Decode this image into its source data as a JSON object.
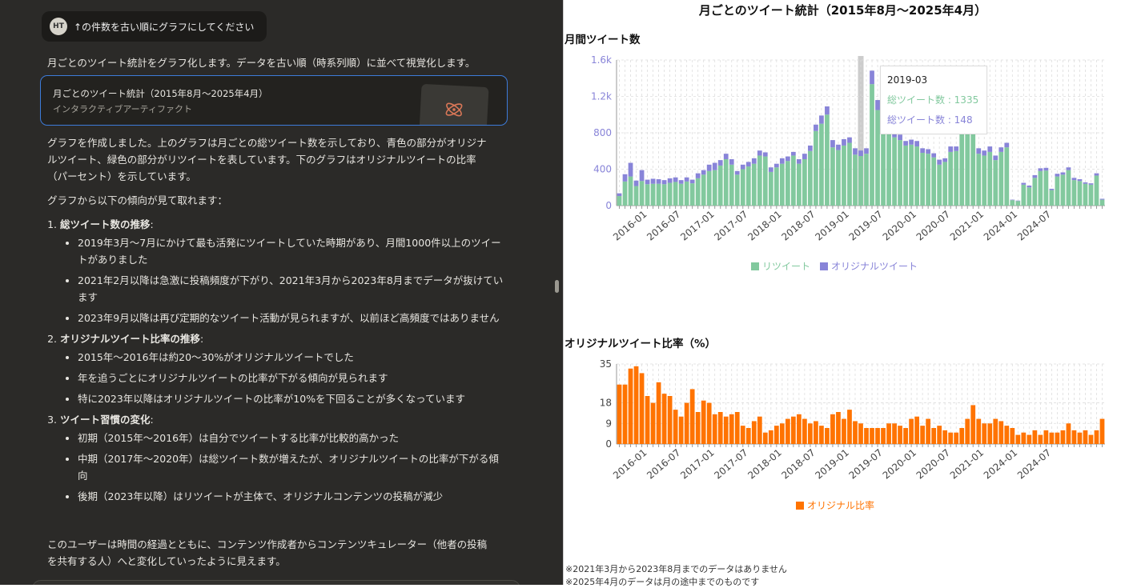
{
  "chat": {
    "user": {
      "initials": "HT",
      "message": "↑の件数を古い順にグラフにしてください"
    },
    "intro": "月ごとのツイート統計をグラフ化します。データを古い順（時系列順）に並べて視覚化します。",
    "artifact": {
      "title": "月ごとのツイート統計（2015年8月〜2025年4月）",
      "subtitle": "インタラクティブアーティファクト",
      "icon": "claude-spark-icon"
    },
    "para1": "グラフを作成しました。上のグラフは月ごとの総ツイート数を示しており、青色の部分がオリジナルツイート、緑色の部分がリツイートを表しています。下のグラフはオリジナルツイートの比率（パーセント）を示しています。",
    "para2": "グラフから以下の傾向が見て取れます：",
    "sections": [
      {
        "heading": "総ツイート数の推移",
        "bullets": [
          "2019年3月〜7月にかけて最も活発にツイートしていた時期があり、月間1000件以上のツイートがありました",
          "2021年2月以降は急激に投稿頻度が下がり、2021年3月から2023年8月までデータが抜けています",
          "2023年9月以降は再び定期的なツイート活動が見られますが、以前ほど高頻度ではありません"
        ]
      },
      {
        "heading": "オリジナルツイート比率の推移",
        "bullets": [
          "2015年〜2016年は約20〜30%がオリジナルツイートでした",
          "年を追うごとにオリジナルツイートの比率が下がる傾向が見られます",
          "特に2023年以降はオリジナルツイートの比率が10%を下回ることが多くなっています"
        ]
      },
      {
        "heading": "ツイート習慣の変化",
        "bullets": [
          "初期（2015年〜2016年）は自分でツイートする比率が比較的高かった",
          "中期（2017年〜2020年）は総ツイート数が増えたが、オリジナルツイートの比率が下がる傾向",
          "後期（2023年以降）はリツイートが主体で、オリジナルコンテンツの投稿が減少"
        ]
      }
    ],
    "conclusion": "このユーザーは時間の経過とともに、コンテンツ作成者からコンテンツキュレーター（他者の投稿を共有する人）へと変化していったように見えます。"
  },
  "viz": {
    "title": "月ごとのツイート統計（2015年8月〜2025年4月）",
    "chart1_title": "月間ツイート数",
    "chart2_title": "オリジナルツイート比率（%）",
    "tooltip": {
      "date": "2019-03",
      "line1": "総ツイート数 : 1335",
      "line2": "総ツイート数 : 148"
    },
    "note1": "※2021年3月から2023年8月までのデータはありません",
    "note2": "※2025年4月のデータは月の途中までのものです"
  },
  "colors": {
    "retweet": "#82c99e",
    "original": "#8884d8",
    "ratio": "#ff7300",
    "axis": "#8884d8"
  },
  "chart_data": [
    {
      "type": "bar",
      "stacked": true,
      "title": "月間ツイート数",
      "ylim": [
        0,
        1600
      ],
      "yticks": [
        "0",
        "400",
        "800",
        "1.2k",
        "1.6k"
      ],
      "xticks": [
        "2016-01",
        "2016-07",
        "2017-01",
        "2017-07",
        "2018-01",
        "2018-07",
        "2019-01",
        "2019-07",
        "2020-01",
        "2020-07",
        "2021-01",
        "2024-01",
        "2024-07"
      ],
      "grid": true,
      "legend_position": "bottom",
      "months": [
        "2015-08",
        "2015-09",
        "2015-10",
        "2015-11",
        "2015-12",
        "2016-01",
        "2016-02",
        "2016-03",
        "2016-04",
        "2016-05",
        "2016-06",
        "2016-07",
        "2016-08",
        "2016-09",
        "2016-10",
        "2016-11",
        "2016-12",
        "2017-01",
        "2017-02",
        "2017-03",
        "2017-04",
        "2017-05",
        "2017-06",
        "2017-07",
        "2017-08",
        "2017-09",
        "2017-10",
        "2017-11",
        "2017-12",
        "2018-01",
        "2018-02",
        "2018-03",
        "2018-04",
        "2018-05",
        "2018-06",
        "2018-07",
        "2018-08",
        "2018-09",
        "2018-10",
        "2018-11",
        "2018-12",
        "2019-01",
        "2019-02",
        "2019-03",
        "2019-04",
        "2019-05",
        "2019-06",
        "2019-07",
        "2019-08",
        "2019-09",
        "2019-10",
        "2019-11",
        "2019-12",
        "2020-01",
        "2020-02",
        "2020-03",
        "2020-04",
        "2020-05",
        "2020-06",
        "2020-07",
        "2020-08",
        "2020-09",
        "2020-10",
        "2020-11",
        "2020-12",
        "2021-01",
        "2021-02",
        "2023-09",
        "2023-10",
        "2023-11",
        "2023-12",
        "2024-01",
        "2024-02",
        "2024-03",
        "2024-04",
        "2024-05",
        "2024-06",
        "2024-07",
        "2024-08",
        "2024-09",
        "2024-10",
        "2024-11",
        "2024-12",
        "2025-01",
        "2025-02",
        "2025-03",
        "2025-04"
      ],
      "series": [
        {
          "name": "リツイート",
          "values": [
            105,
            265,
            320,
            215,
            270,
            235,
            240,
            240,
            235,
            250,
            260,
            240,
            265,
            245,
            300,
            340,
            380,
            390,
            440,
            510,
            450,
            340,
            400,
            430,
            460,
            550,
            540,
            370,
            420,
            460,
            490,
            550,
            460,
            510,
            600,
            820,
            900,
            1000,
            640,
            610,
            660,
            690,
            560,
            545,
            570,
            1335,
            1050,
            980,
            900,
            750,
            720,
            660,
            670,
            650,
            580,
            570,
            530,
            450,
            480,
            590,
            600,
            1020,
            950,
            950,
            570,
            550,
            590,
            500,
            590,
            640,
            60,
            50,
            230,
            200,
            305,
            380,
            385,
            170,
            320,
            340,
            390,
            280,
            270,
            240,
            230,
            330,
            65
          ]
        },
        {
          "name": "オリジナルツイート",
          "values": [
            30,
            80,
            150,
            60,
            120,
            50,
            55,
            50,
            45,
            50,
            50,
            40,
            45,
            40,
            55,
            50,
            70,
            80,
            60,
            60,
            60,
            40,
            50,
            50,
            60,
            55,
            45,
            50,
            40,
            60,
            50,
            40,
            50,
            60,
            60,
            70,
            90,
            90,
            80,
            60,
            70,
            60,
            70,
            60,
            60,
            148,
            110,
            110,
            90,
            70,
            60,
            50,
            55,
            60,
            50,
            50,
            45,
            55,
            40,
            60,
            50,
            90,
            80,
            70,
            60,
            55,
            60,
            50,
            50,
            50,
            5,
            5,
            20,
            20,
            30,
            30,
            30,
            15,
            30,
            25,
            30,
            25,
            20,
            15,
            15,
            25,
            10
          ]
        }
      ]
    },
    {
      "type": "bar",
      "title": "オリジナルツイート比率（%）",
      "ylim": [
        0,
        35
      ],
      "yticks": [
        0,
        9,
        18,
        35
      ],
      "xticks": [
        "2016-01",
        "2016-07",
        "2017-01",
        "2017-07",
        "2018-01",
        "2018-07",
        "2019-01",
        "2019-07",
        "2020-01",
        "2020-07",
        "2021-01",
        "2024-01",
        "2024-07"
      ],
      "grid": true,
      "legend_position": "bottom",
      "series": [
        {
          "name": "オリジナル比率",
          "values": [
            26,
            26,
            33,
            34,
            31,
            21,
            18,
            27,
            22,
            21,
            15,
            12,
            18,
            24,
            14,
            19,
            18,
            13,
            14,
            12,
            13,
            14,
            8,
            7,
            10,
            12,
            5,
            6,
            8,
            9,
            11,
            12,
            13,
            11,
            9,
            10,
            8,
            7,
            13,
            14,
            11,
            15,
            10,
            9,
            7,
            7,
            7,
            7,
            9,
            9,
            8,
            7,
            11,
            12,
            8,
            11,
            7,
            8,
            6,
            5,
            5,
            7,
            11,
            17,
            11,
            9,
            9,
            11,
            10,
            8,
            7,
            4,
            5,
            4,
            6,
            4,
            6,
            5,
            5,
            6,
            9,
            6,
            5,
            6,
            4,
            6,
            11
          ]
        }
      ]
    }
  ],
  "legend1": {
    "retweet": "リツイート",
    "original": "オリジナルツイート"
  },
  "legend2": {
    "ratio": "オリジナル比率"
  }
}
